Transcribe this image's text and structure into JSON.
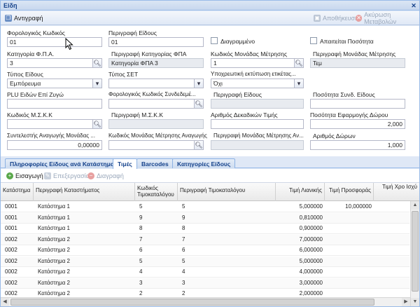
{
  "window": {
    "title": "Είδη",
    "close_glyph": "✕"
  },
  "toolbar": {
    "copy_label": "Αντιγραφή",
    "save_label": "Αποθήκευση",
    "cancel_label": "Ακύρωση Μεταβολών"
  },
  "form": {
    "tax_code_label": "Φορολογικός Κωδικός",
    "tax_code_value": "01",
    "description_label": "Περιγραφή Είδους",
    "description_value": "01",
    "deleted_label": "Διαγραμμένο",
    "requires_qty_label": "Απαιτείται Ποσότητα",
    "vat_cat_label": "Κατηγορία Φ.Π.Α.",
    "vat_cat_value": "3",
    "vat_cat_desc_label": "Περιγραφή Κατηγορίας ΦΠΑ",
    "vat_cat_desc_value": "Κατηγορία ΦΠΑ 3",
    "unit_code_label": "Κωδικός Μονάδας Μέτρησης",
    "unit_code_value": "1",
    "unit_desc_label": "Περιγραφή Μονάδας Μέτρησης",
    "unit_desc_value": "Τεμ",
    "item_type_label": "Τύπος Είδους",
    "item_type_value": "Εμπόρευμα",
    "set_type_label": "Τύπος ΣΕΤ",
    "set_type_value": "",
    "mandatory_print_label": "Υποχρεωτική εκτύπωση ετικέτας...",
    "mandatory_print_value": "Όχι",
    "plu_label": "PLU Ειδών Επί Ζυγώ",
    "plu_value": "",
    "related_tax_code_label": "Φορολογικός Κωδικός Συνδεδεμέ...",
    "related_tax_code_value": "",
    "related_desc_label": "Περιγραφή Είδους",
    "related_desc_value": "",
    "related_qty_label": "Ποσότητα Συνδ. Είδους",
    "related_qty_value": "",
    "mskk_code_label": "Κωδικός Μ.Σ.Κ.Κ",
    "mskk_code_value": "",
    "mskk_desc_label": "Περιγραφή Μ.Σ.Κ.Κ",
    "mskk_desc_value": "",
    "decimals_label": "Αριθμός Δεκαδικών Τιμής",
    "decimals_value": "",
    "gift_qty_label": "Ποσότητα Εφαρμογής Δώρου",
    "gift_qty_value": "2,000",
    "conv_factor_label": "Συντελεστής Αναγωγής Μονάδας ...",
    "conv_factor_value": "0,00000",
    "conv_unit_code_label": "Κωδικός Μονάδας Μέτρησης Αναγωγής",
    "conv_unit_code_value": "",
    "conv_unit_desc_label": "Περιγραφή Μονάδας Μέτρησης Αν...",
    "conv_unit_desc_value": "",
    "gifts_count_label": "Αριθμός Δώρων",
    "gifts_count_value": "1,000"
  },
  "tabs": [
    {
      "label": "Πληροφορίες Είδους ανά Κατάστημα"
    },
    {
      "label": "Τιμές"
    },
    {
      "label": "Barcodes"
    },
    {
      "label": "Κατηγορίες Είδους"
    }
  ],
  "subtoolbar": {
    "add_label": "Εισαγωγή",
    "edit_label": "Επεξεργασία",
    "delete_label": "Διαγραφή"
  },
  "grid": {
    "columns": [
      "Κατάστημα",
      "Περιγραφή Καταστήματος",
      "Κωδικός Τιμοκαταλόγου",
      "Περιγραφή Τιμοκαταλόγου",
      "Τιμή Λιανικής",
      "Τιμή Προσφοράς",
      "Τιμή Χρο Ισχύ"
    ],
    "rows": [
      {
        "store": "0001",
        "store_desc": "Κατάστημα 1",
        "pl_code": "5",
        "pl_desc": "5",
        "retail": "5,000000",
        "offer": "10,000000"
      },
      {
        "store": "0001",
        "store_desc": "Κατάστημα 1",
        "pl_code": "9",
        "pl_desc": "9",
        "retail": "0,810000",
        "offer": ""
      },
      {
        "store": "0001",
        "store_desc": "Κατάστημα 1",
        "pl_code": "8",
        "pl_desc": "8",
        "retail": "0,900000",
        "offer": ""
      },
      {
        "store": "0002",
        "store_desc": "Κατάστημα 2",
        "pl_code": "7",
        "pl_desc": "7",
        "retail": "7,000000",
        "offer": ""
      },
      {
        "store": "0002",
        "store_desc": "Κατάστημα 2",
        "pl_code": "6",
        "pl_desc": "6",
        "retail": "6,000000",
        "offer": ""
      },
      {
        "store": "0002",
        "store_desc": "Κατάστημα 2",
        "pl_code": "5",
        "pl_desc": "5",
        "retail": "5,000000",
        "offer": ""
      },
      {
        "store": "0002",
        "store_desc": "Κατάστημα 2",
        "pl_code": "4",
        "pl_desc": "4",
        "retail": "4,000000",
        "offer": ""
      },
      {
        "store": "0002",
        "store_desc": "Κατάστημα 2",
        "pl_code": "3",
        "pl_desc": "3",
        "retail": "3,000000",
        "offer": ""
      },
      {
        "store": "0002",
        "store_desc": "Κατάστημα 2",
        "pl_code": "2",
        "pl_desc": "2",
        "retail": "2,000000",
        "offer": ""
      }
    ]
  },
  "colors": {
    "accent": "#15428b",
    "border": "#99bbe8"
  }
}
